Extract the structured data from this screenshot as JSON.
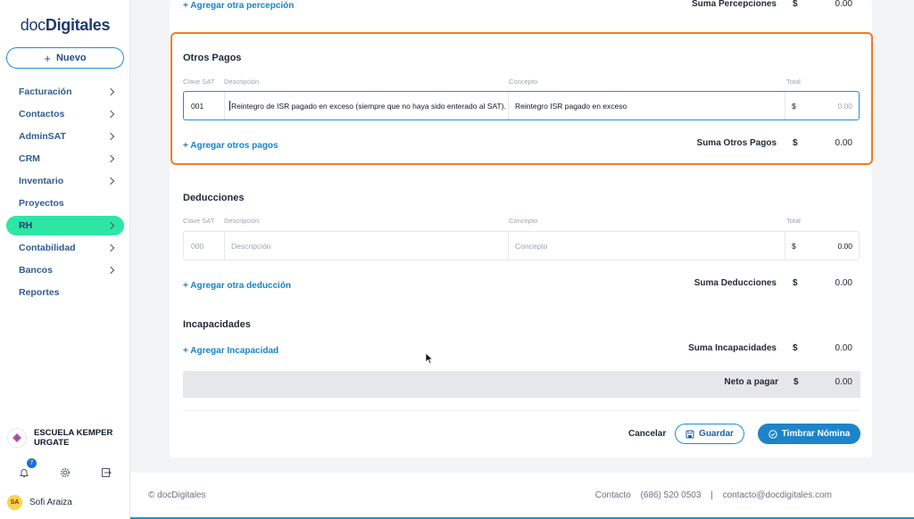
{
  "sidebar": {
    "logo_light": "doc",
    "logo_bold": "Digitales",
    "new_button": "Nuevo",
    "items": [
      {
        "label": "Facturación",
        "has_chevron": true
      },
      {
        "label": "Contactos",
        "has_chevron": true
      },
      {
        "label": "AdminSAT",
        "has_chevron": true
      },
      {
        "label": "CRM",
        "has_chevron": true
      },
      {
        "label": "Inventario",
        "has_chevron": true
      },
      {
        "label": "Proyectos",
        "has_chevron": false
      },
      {
        "label": "RH",
        "has_chevron": true,
        "active": true
      },
      {
        "label": "Contabilidad",
        "has_chevron": true
      },
      {
        "label": "Bancos",
        "has_chevron": true
      },
      {
        "label": "Reportes",
        "has_chevron": false
      }
    ],
    "org_name_line1": "ESCUELA KEMPER",
    "org_name_line2": "URGATE",
    "notifications_count": "7",
    "user_initials": "SA",
    "user_name": "Sofi Araiza"
  },
  "percepciones": {
    "add_link": "+ Agregar otra percepción",
    "sum_label": "Suma Percepciones",
    "currency": "$",
    "sum_value": "0.00"
  },
  "otros_pagos": {
    "title": "Otros Pagos",
    "headers": {
      "clave": "Clave SAT",
      "descripcion": "Descripción",
      "concepto": "Concepto",
      "total": "Total"
    },
    "row": {
      "clave": "001",
      "descripcion": "Reintegro de ISR pagado en exceso (siempre que no haya sido enterado al SAT).",
      "concepto": "Reintegro ISR pagado en exceso",
      "currency": "$",
      "total_placeholder": "0.00"
    },
    "add_link": "+ Agregar otros pagos",
    "sum_label": "Suma Otros Pagos",
    "currency": "$",
    "sum_value": "0.00"
  },
  "deducciones": {
    "title": "Deducciones",
    "headers": {
      "clave": "Clave SAT",
      "descripcion": "Descripción",
      "concepto": "Concepto",
      "total": "Total"
    },
    "row": {
      "clave_placeholder": "000",
      "descripcion_placeholder": "Descripción",
      "concepto_placeholder": "Concepto",
      "currency": "$",
      "total": "0.00"
    },
    "add_link": "+ Agregar otra deducción",
    "sum_label": "Suma Deducciones",
    "currency": "$",
    "sum_value": "0.00"
  },
  "incapacidades": {
    "title": "Incapacidades",
    "add_link": "+ Agregar Incapacidad",
    "sum_label": "Suma Incapacidades",
    "currency": "$",
    "sum_value": "0.00"
  },
  "neto": {
    "label": "Neto a pagar",
    "currency": "$",
    "value": "0.00"
  },
  "actions": {
    "cancel": "Cancelar",
    "save": "Guardar",
    "stamp": "Timbrar Nómina"
  },
  "footer": {
    "copyright": "© docDigitales",
    "contact_label": "Contacto",
    "phone": "(686) 520 0503",
    "separator": "|",
    "email": "contacto@docdigitales.com"
  },
  "colors": {
    "accent": "#1d84c8",
    "active_nav": "#2ee6a3",
    "highlight": "#f07c22"
  }
}
